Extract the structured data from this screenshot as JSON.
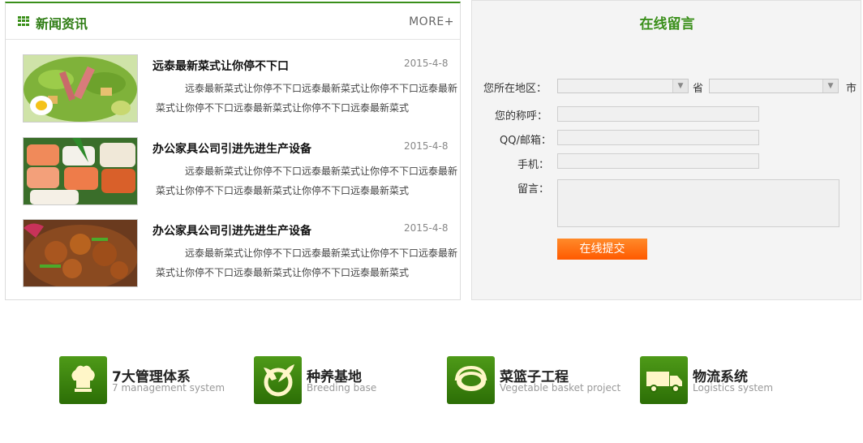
{
  "news": {
    "title": "新闻资讯",
    "more": "MORE+",
    "items": [
      {
        "title": "远泰最新菜式让你停不下口",
        "date": "2015-4-8",
        "desc": "远泰最新菜式让你停不下口远泰最新菜式让你停不下口远泰最新菜式让你停不下口远泰最新菜式让你停不下口远泰最新菜式",
        "image": "salad-image"
      },
      {
        "title": "办公家具公司引进先进生产设备",
        "date": "2015-4-8",
        "desc": "远泰最新菜式让你停不下口远泰最新菜式让你停不下口远泰最新菜式让你停不下口远泰最新菜式让你停不下口远泰最新菜式",
        "image": "sushi-image"
      },
      {
        "title": "办公家具公司引进先进生产设备",
        "date": "2015-4-8",
        "desc": "远泰最新菜式让你停不下口远泰最新菜式让你停不下口远泰最新菜式让你停不下口远泰最新菜式让你停不下口远泰最新菜式",
        "image": "chicken-dish-image"
      }
    ]
  },
  "message": {
    "title": "在线留言",
    "region_label": "您所在地区：",
    "province_unit": "省",
    "city_unit": "市",
    "name_label": "您的称呼：",
    "qq_label": "QQ/邮箱：",
    "phone_label": "手机：",
    "message_label": "留言：",
    "submit_label": "在线提交"
  },
  "features": [
    {
      "title": "7大管理体系",
      "subtitle": "7 management system",
      "icon": "chef-hat-icon"
    },
    {
      "title": "种养基地",
      "subtitle": "Breeding base",
      "icon": "sprout-icon"
    },
    {
      "title": "菜篮子工程",
      "subtitle": "Vegetable basket project",
      "icon": "basket-icon"
    },
    {
      "title": "物流系统",
      "subtitle": "Logistics system",
      "icon": "truck-icon"
    }
  ],
  "colors": {
    "accent": "#3a8f1a",
    "button": "#ff6a00",
    "panel_bg": "#f4f4f4"
  }
}
